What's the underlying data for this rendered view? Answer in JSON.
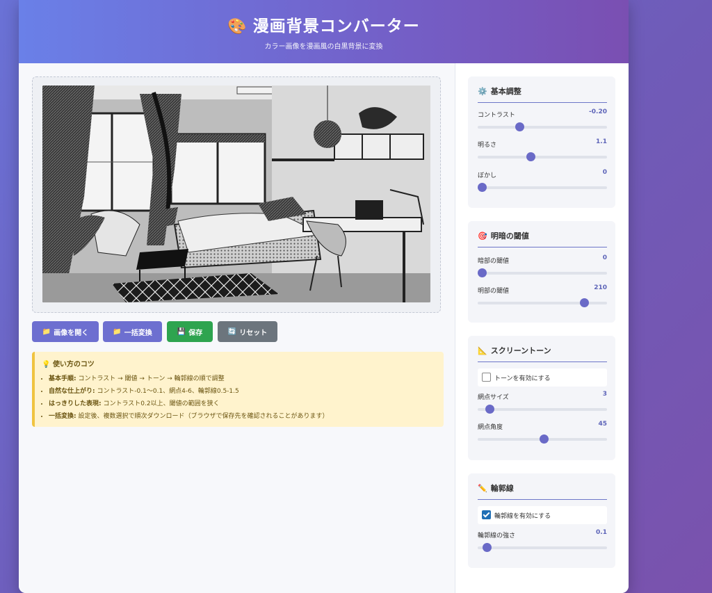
{
  "header": {
    "icon": "palette-icon",
    "title": "漫画背景コンバーター",
    "subtitle": "カラー画像を漫画風の白黒背景に変換"
  },
  "buttons": {
    "open": "画像を開く",
    "batch": "一括変換",
    "save": "保存",
    "reset": "リセット"
  },
  "tips": {
    "title": "使い方のコツ",
    "items": [
      {
        "label": "基本手順:",
        "text": " コントラスト → 閾値 → トーン → 輪郭線の順で調整"
      },
      {
        "label": "自然な仕上がり:",
        "text": " コントラスト-0.1〜0.1、網点4-6、輪郭線0.5-1.5"
      },
      {
        "label": "はっきりした表現:",
        "text": " コントラスト0.2以上、閾値の範囲を狭く"
      },
      {
        "label": "一括変換:",
        "text": " 設定後、複数選択で順次ダウンロード（ブラウザで保存先を確認されることがあります）"
      }
    ]
  },
  "panels": {
    "basic": {
      "icon": "gear-icon",
      "title": "基本調整",
      "sliders": [
        {
          "label": "コントラスト",
          "value": "-0.20",
          "fraction": 0.32
        },
        {
          "label": "明るさ",
          "value": "1.1",
          "fraction": 0.41
        },
        {
          "label": "ぼかし",
          "value": "0",
          "fraction": 0.03
        }
      ]
    },
    "threshold": {
      "icon": "target-icon",
      "title": "明暗の閾値",
      "sliders": [
        {
          "label": "暗部の閾値",
          "value": "0",
          "fraction": 0.03
        },
        {
          "label": "明部の閾値",
          "value": "210",
          "fraction": 0.82
        }
      ]
    },
    "tone": {
      "icon": "triangle-ruler-icon",
      "title": "スクリーントーン",
      "checkbox": {
        "label": "トーンを有効にする",
        "checked": false
      },
      "sliders": [
        {
          "label": "網点サイズ",
          "value": "3",
          "fraction": 0.09
        },
        {
          "label": "網点角度",
          "value": "45",
          "fraction": 0.51
        }
      ]
    },
    "outline": {
      "icon": "pencil-icon",
      "title": "輪郭線",
      "checkbox": {
        "label": "輪郭線を有効にする",
        "checked": true
      },
      "sliders": [
        {
          "label": "輪郭線の強さ",
          "value": "0.1",
          "fraction": 0.07
        }
      ]
    }
  },
  "colors": {
    "accent": "#6a6ac7",
    "save": "#2ea44f",
    "reset": "#6c757d",
    "tips_bg": "#fff3cd"
  }
}
